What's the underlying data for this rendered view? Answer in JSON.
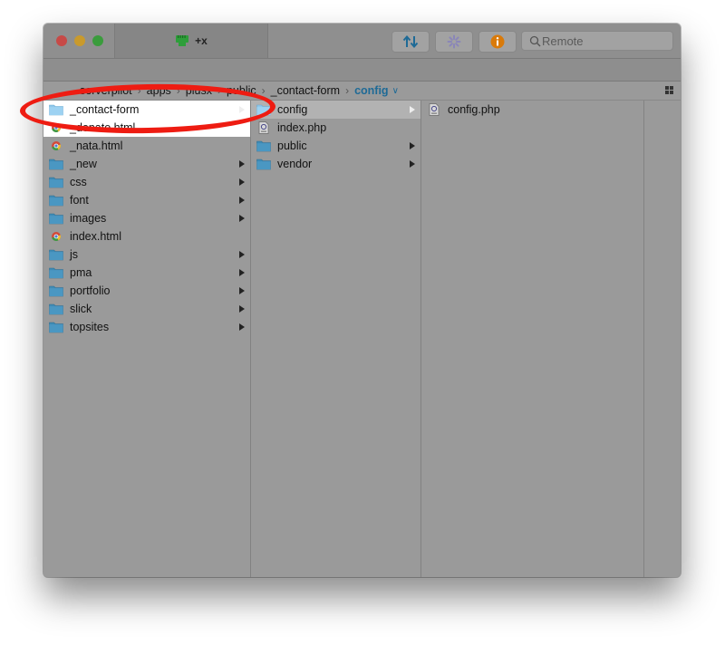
{
  "titlebar": {
    "tab_label": "+x",
    "buttons": [
      {
        "name": "sync",
        "icon": "arrows-up-down-icon"
      },
      {
        "name": "activity",
        "icon": "spinner-icon"
      },
      {
        "name": "info",
        "icon": "info-icon"
      }
    ],
    "search_placeholder": "Remote"
  },
  "colors": {
    "accent": "#1e6a96",
    "annotation": "#ee1c12",
    "folder": "#3f8bb5",
    "info": "#d97a0a",
    "plug": "#2e9e3a"
  },
  "breadcrumb": [
    "serverpilot",
    "apps",
    "plusx",
    "public",
    "_contact-form"
  ],
  "breadcrumb_current": "config",
  "columns": {
    "col1": [
      {
        "name": "_contact-form",
        "type": "folder",
        "has_children": true,
        "selected": true
      },
      {
        "name": "_donate.html",
        "type": "html"
      },
      {
        "name": "_nata.html",
        "type": "html"
      },
      {
        "name": "_new",
        "type": "folder",
        "has_children": true
      },
      {
        "name": "css",
        "type": "folder",
        "has_children": true
      },
      {
        "name": "font",
        "type": "folder",
        "has_children": true
      },
      {
        "name": "images",
        "type": "folder",
        "has_children": true
      },
      {
        "name": "index.html",
        "type": "html"
      },
      {
        "name": "js",
        "type": "folder",
        "has_children": true
      },
      {
        "name": "pma",
        "type": "folder",
        "has_children": true
      },
      {
        "name": "portfolio",
        "type": "folder",
        "has_children": true
      },
      {
        "name": "slick",
        "type": "folder",
        "has_children": true
      },
      {
        "name": "topsites",
        "type": "folder",
        "has_children": true
      }
    ],
    "col2": [
      {
        "name": "config",
        "type": "folder",
        "has_children": true,
        "selected": true
      },
      {
        "name": "index.php",
        "type": "php"
      },
      {
        "name": "public",
        "type": "folder",
        "has_children": true
      },
      {
        "name": "vendor",
        "type": "folder",
        "has_children": true
      }
    ],
    "col3": [
      {
        "name": "config.php",
        "type": "php"
      }
    ]
  }
}
